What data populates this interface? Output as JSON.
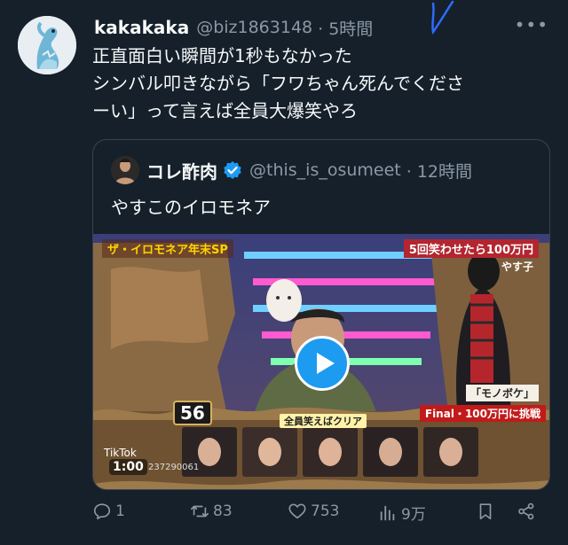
{
  "tweet": {
    "author_name": "kakakaka",
    "author_handle": "@biz1863148",
    "time": "· 5時間",
    "more_icon": "more-icon",
    "text_lines": [
      "正直面白い瞬間が1秒もなかった",
      "シンバル叩きながら「フワちゃん死んでくださ",
      "ーい」って言えば全員大爆笑やろ"
    ]
  },
  "quote": {
    "author_name": "コレ酢肉",
    "author_handle": "@this_is_osumeet",
    "time": "· 12時間",
    "text": "やすこのイロモネア",
    "verified_icon": "verified-badge-icon"
  },
  "video": {
    "title_caption": "ザ・イロモネア年末SP",
    "prize_caption": "5回笑わせたら100万円",
    "performer_caption": "やす子",
    "genre_caption": "「モノボケ」",
    "final_caption": "Final・100万円に挑戦",
    "counter": "56",
    "clear_caption": "全員笑えばクリア",
    "tiktok_label": "TikTok",
    "duration": "1:00",
    "tiktok_id": "237290061"
  },
  "actions": {
    "reply_count": "1",
    "retweet_count": "83",
    "like_count": "753",
    "views_count": "9万"
  },
  "colors": {
    "background": "#15202b",
    "accent": "#1d9bf0",
    "secondary_text": "#8b98a5",
    "border": "#38444d"
  }
}
